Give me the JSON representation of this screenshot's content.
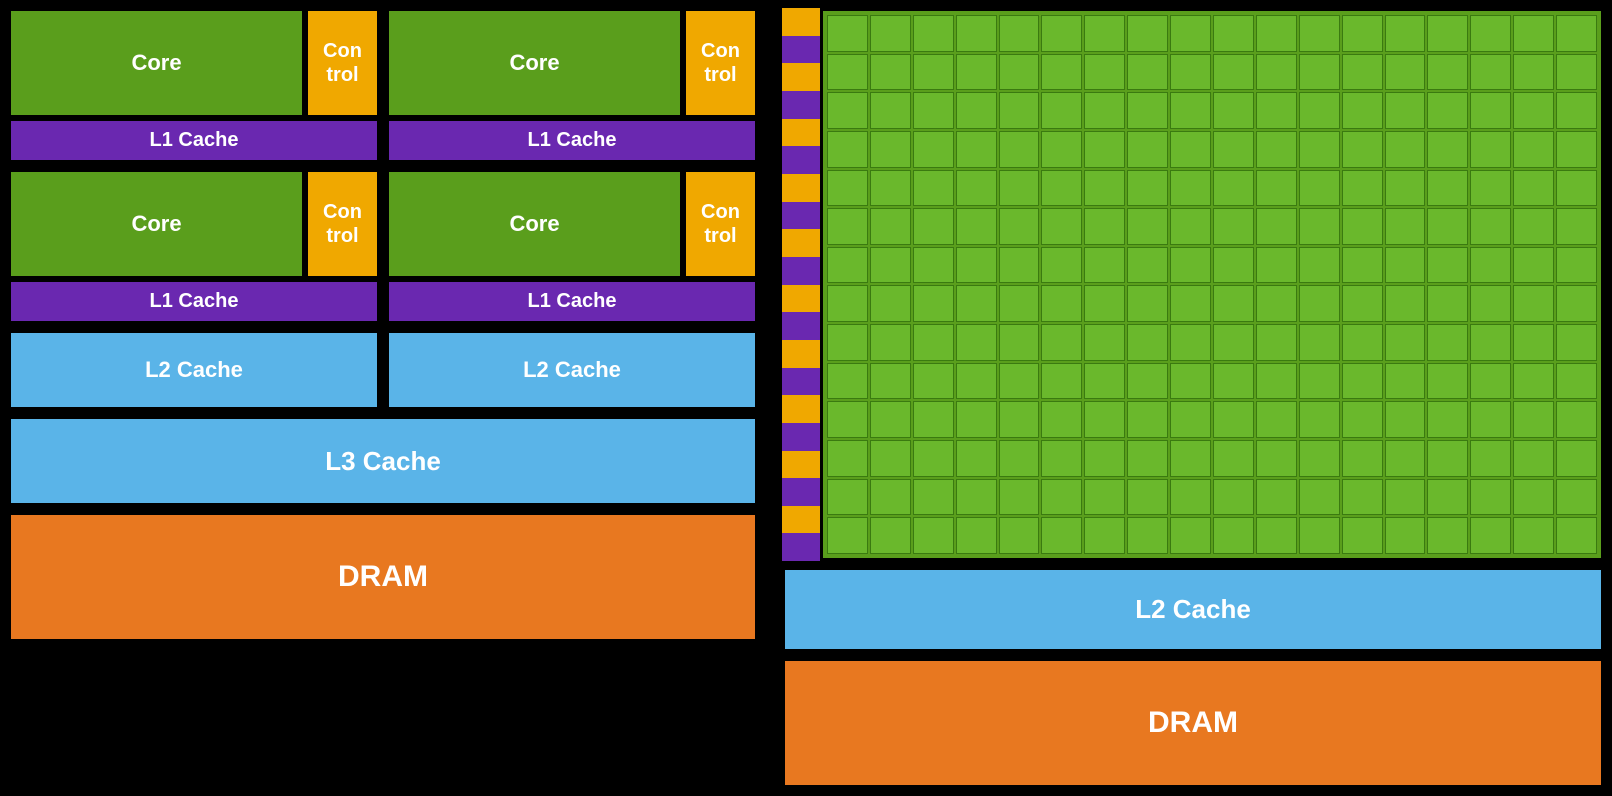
{
  "left": {
    "core_label": "Core",
    "control_label": "Con\ntrol",
    "l1_cache_label": "L1 Cache",
    "l2_cache_label": "L2 Cache",
    "l3_cache_label": "L3 Cache",
    "dram_label": "DRAM"
  },
  "right": {
    "l2_cache_label": "L2 Cache",
    "dram_label": "DRAM",
    "grid_cols": 18,
    "grid_rows": 14
  },
  "colors": {
    "green": "#5a9e1c",
    "gold": "#f0a800",
    "purple": "#6a28b0",
    "blue": "#5ab4e8",
    "orange": "#e87820",
    "black": "#000000"
  }
}
